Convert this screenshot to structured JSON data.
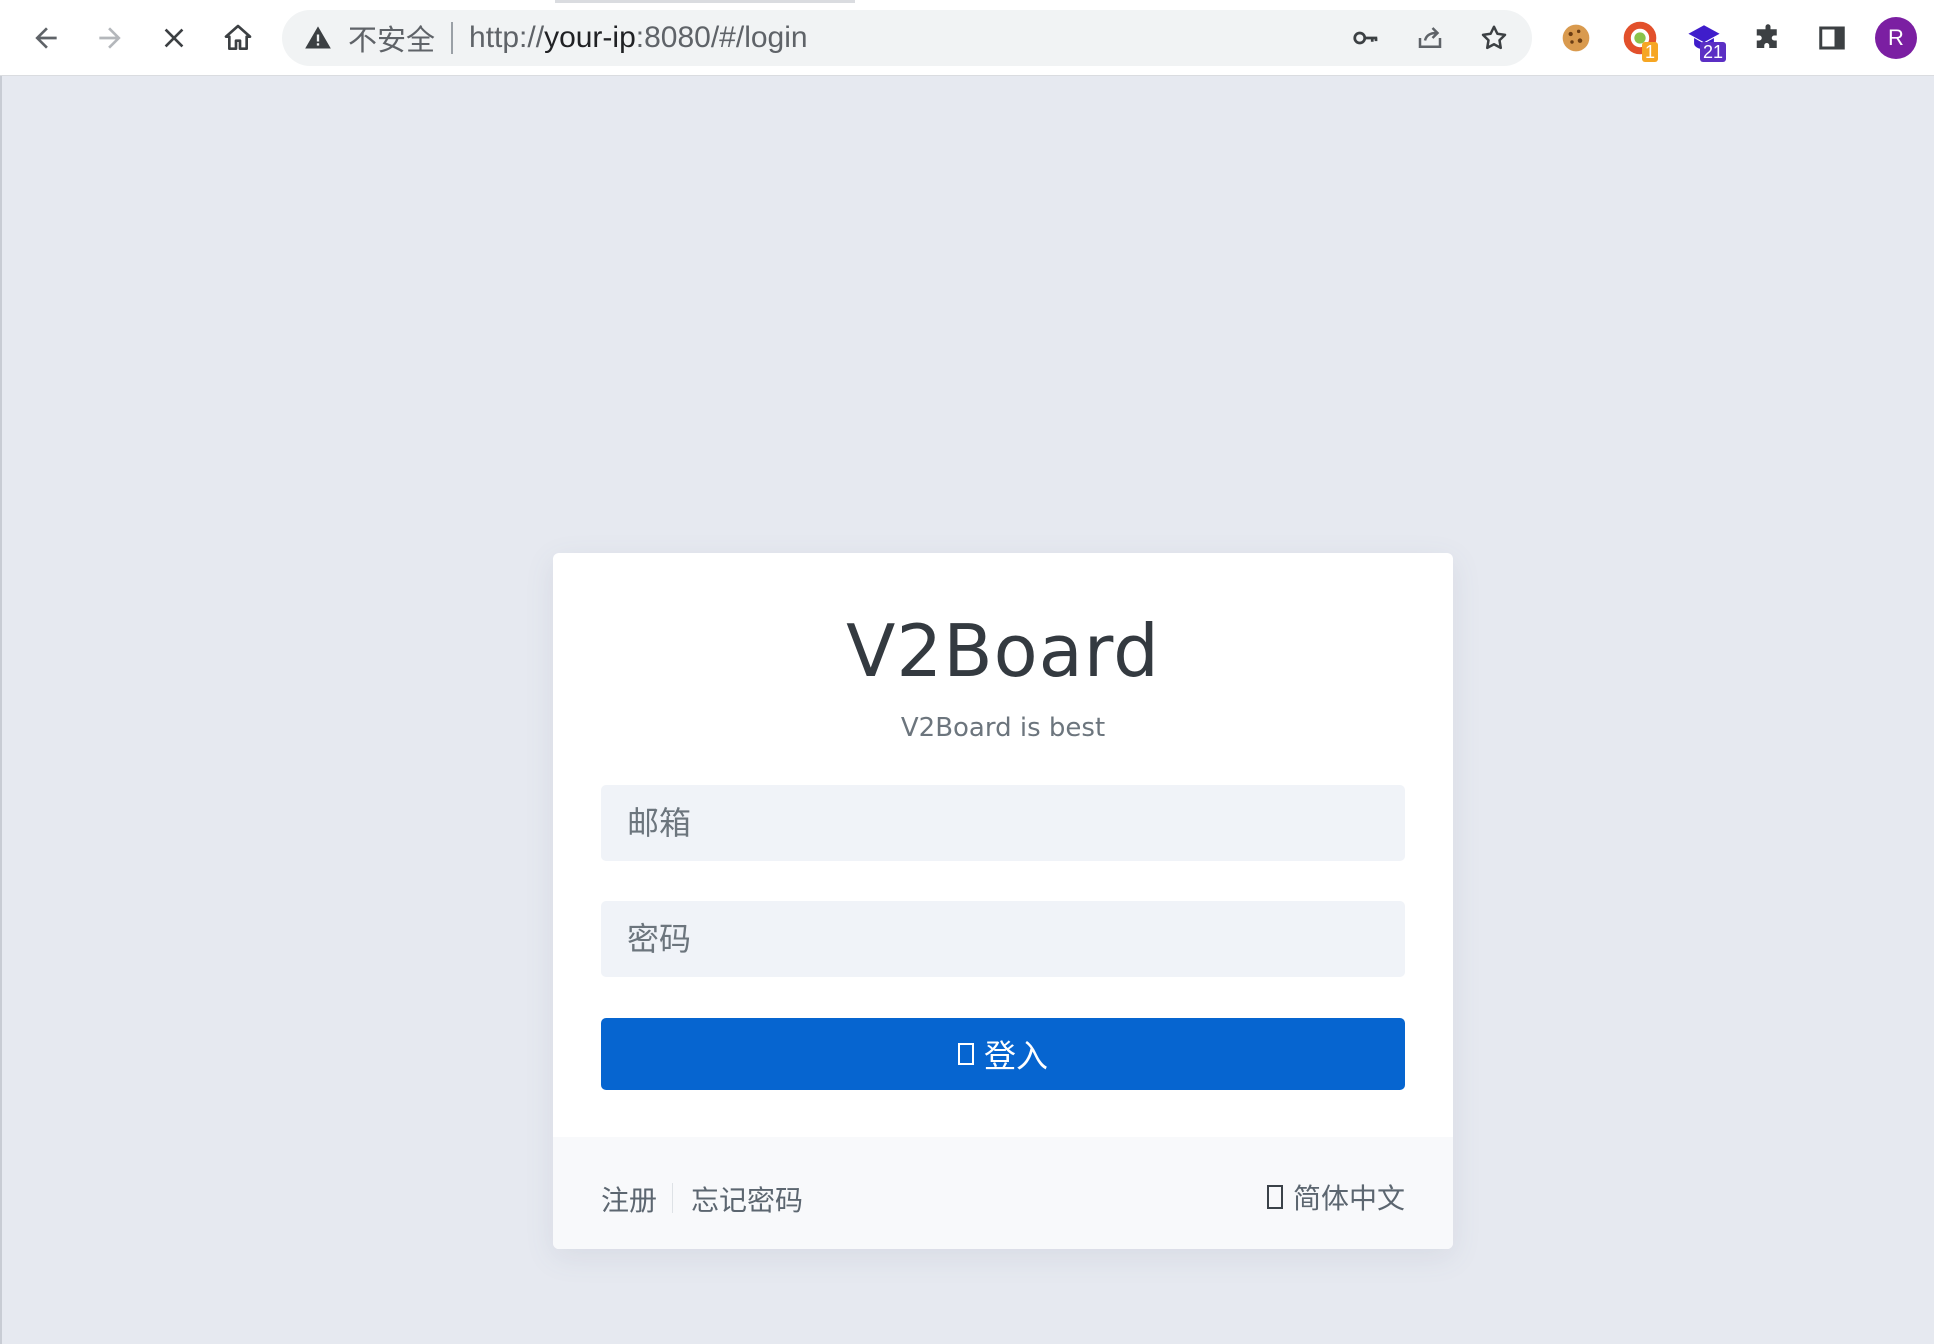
{
  "browser": {
    "security_label": "不安全",
    "url_scheme": "http://",
    "url_host": "your-ip",
    "url_rest": ":8080/#/login",
    "extensions": [
      {
        "name": "cookie-extension",
        "badge": ""
      },
      {
        "name": "circle-extension",
        "badge": "1",
        "badge_color": "#f6a623"
      },
      {
        "name": "graduation-extension",
        "badge": "21",
        "badge_color": "#5b2fc4"
      }
    ],
    "profile_initial": "R"
  },
  "login": {
    "title": "V2Board",
    "subtitle": "V2Board is best",
    "email_placeholder": "邮箱",
    "password_placeholder": "密码",
    "submit_label": "登入",
    "accent_color": "#0665d0"
  },
  "footer": {
    "register_label": "注册",
    "forgot_label": "忘记密码",
    "language_label": "简体中文"
  }
}
